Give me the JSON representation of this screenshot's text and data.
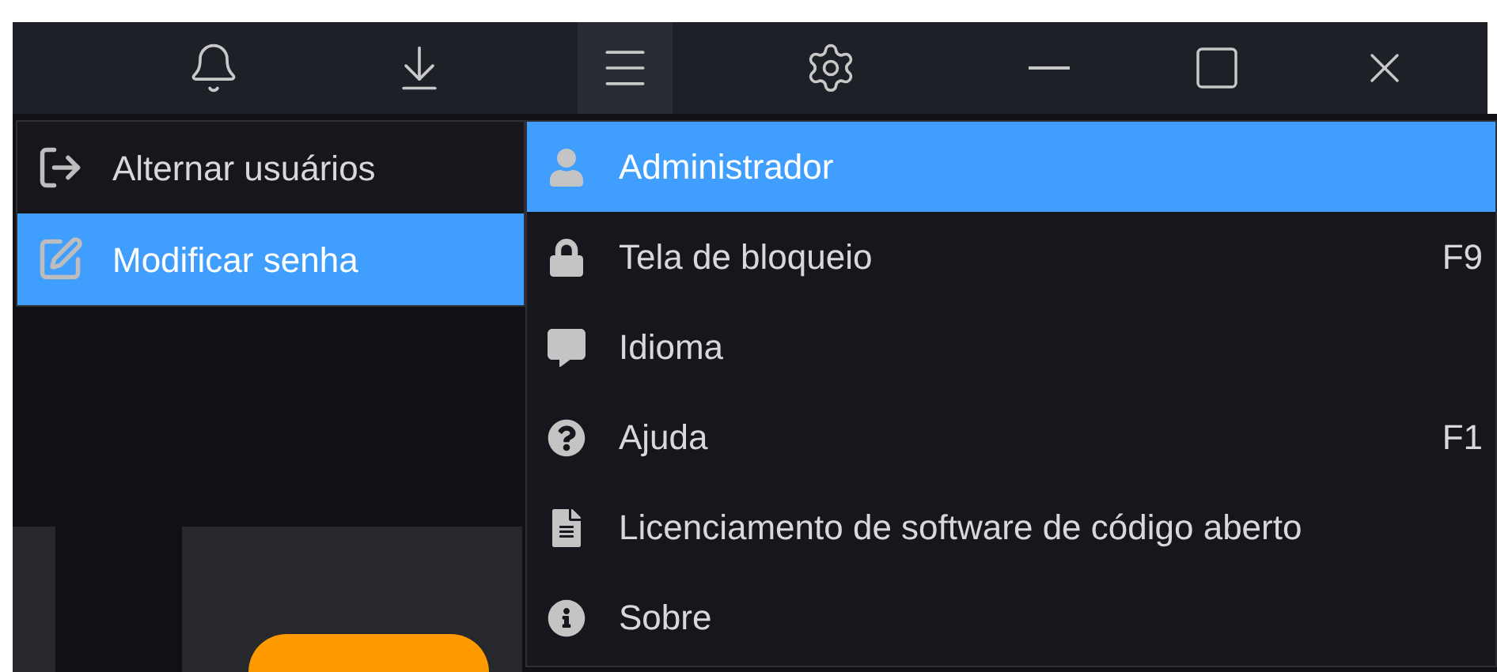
{
  "toolbar": [
    {
      "kind": "bell",
      "selected": false
    },
    {
      "kind": "download",
      "selected": false
    },
    {
      "kind": "menu",
      "selected": true
    },
    {
      "kind": "settings",
      "selected": false
    }
  ],
  "window_controls": [
    {
      "kind": "minimize"
    },
    {
      "kind": "maximize"
    },
    {
      "kind": "close"
    }
  ],
  "submenu": {
    "items": [
      {
        "kind": "switch-user",
        "label": "Alternar usuários",
        "selected": false
      },
      {
        "kind": "edit",
        "label": "Modificar senha",
        "selected": true
      }
    ]
  },
  "menu": {
    "items": [
      {
        "kind": "user",
        "label": "Administrador",
        "selected": true
      },
      {
        "kind": "lock",
        "label": "Tela de bloqueio",
        "shortcut": "F9",
        "selected": false
      },
      {
        "kind": "language",
        "label": "Idioma",
        "selected": false
      },
      {
        "kind": "help",
        "label": "Ajuda",
        "shortcut": "F1",
        "selected": false
      },
      {
        "kind": "document",
        "label": "Licenciamento de software de código aberto",
        "selected": false
      },
      {
        "kind": "info",
        "label": "Sobre",
        "selected": false
      }
    ]
  }
}
